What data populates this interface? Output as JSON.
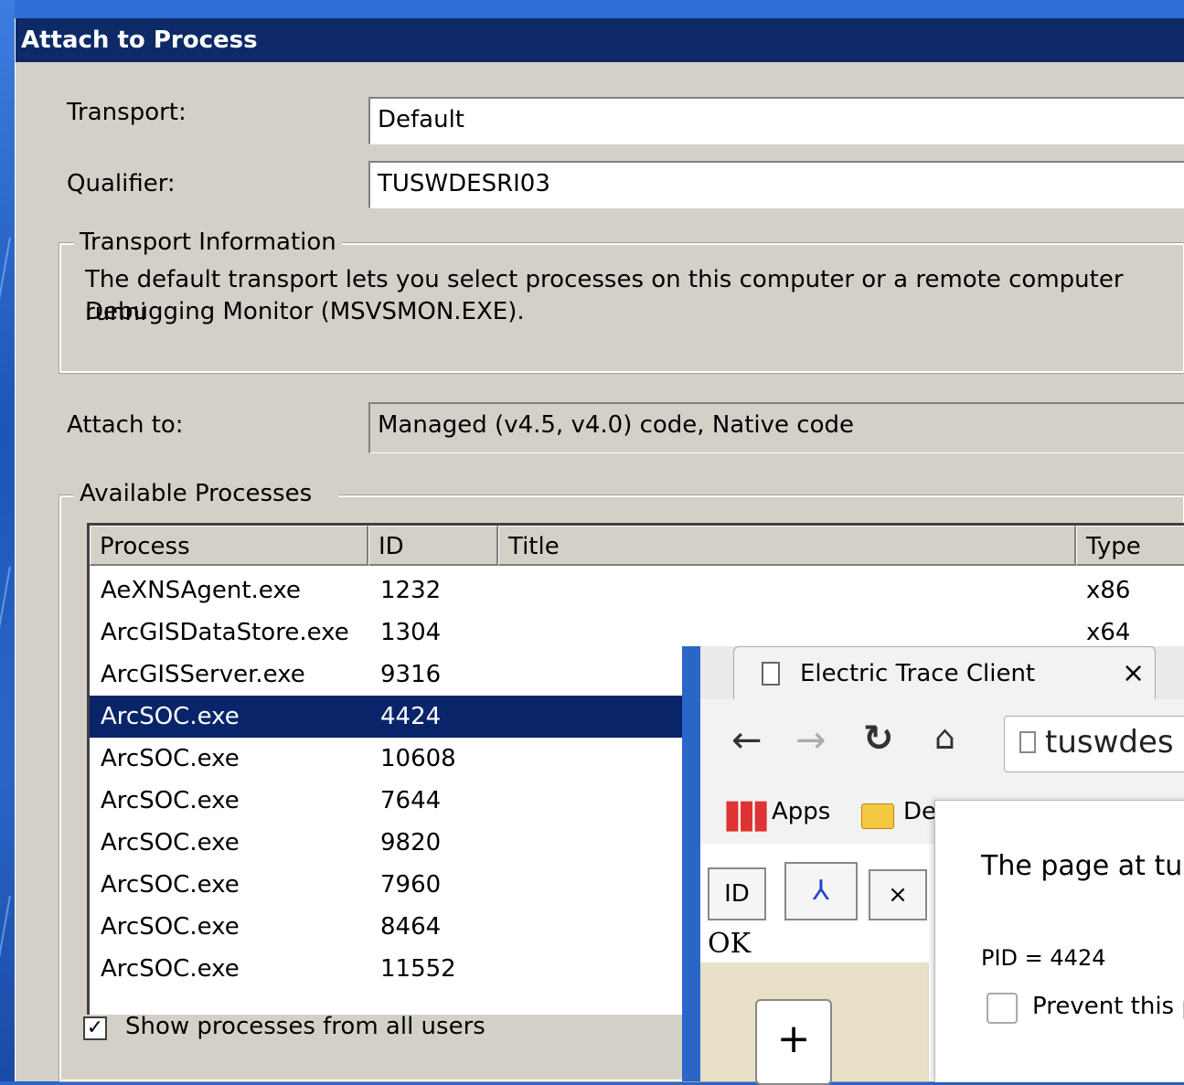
{
  "dialog": {
    "title": "Attach to Process",
    "transport_label": "Transport:",
    "transport_value": "Default",
    "qualifier_label": "Qualifier:",
    "qualifier_value": "TUSWDESRI03",
    "transport_info_title": "Transport Information",
    "transport_info_line1": "The default transport lets you select processes on this computer or a remote computer runni",
    "transport_info_line2": "Debugging Monitor (MSVSMON.EXE).",
    "attach_to_label": "Attach to:",
    "attach_to_value": "Managed (v4.5, v4.0) code, Native code",
    "available_processes_title": "Available Processes",
    "columns": [
      "Process",
      "ID",
      "Title",
      "Type"
    ],
    "processes": [
      {
        "process": "AeXNSAgent.exe",
        "id": "1232",
        "title": "",
        "type": "x86"
      },
      {
        "process": "ArcGISDataStore.exe",
        "id": "1304",
        "title": "",
        "type": "x64"
      },
      {
        "process": "ArcGISServer.exe",
        "id": "9316",
        "title": "",
        "type": ""
      },
      {
        "process": "ArcSOC.exe",
        "id": "4424",
        "title": "",
        "type": ""
      },
      {
        "process": "ArcSOC.exe",
        "id": "10608",
        "title": "",
        "type": ""
      },
      {
        "process": "ArcSOC.exe",
        "id": "7644",
        "title": "",
        "type": ""
      },
      {
        "process": "ArcSOC.exe",
        "id": "9820",
        "title": "",
        "type": ""
      },
      {
        "process": "ArcSOC.exe",
        "id": "7960",
        "title": "",
        "type": ""
      },
      {
        "process": "ArcSOC.exe",
        "id": "8464",
        "title": "",
        "type": ""
      },
      {
        "process": "ArcSOC.exe",
        "id": "11552",
        "title": "",
        "type": ""
      }
    ],
    "selected_index": 3,
    "show_all_users_label": "Show processes from all users",
    "show_all_users_checked": true
  },
  "browser": {
    "tab_title": "Electric Trace Client",
    "address": "tuswdes",
    "bookmark_apps": "Apps",
    "bookmark_folder": "De",
    "tool_id_label": "ID",
    "tool_close_label": "×",
    "ok_label": "OK",
    "zoom_in_label": "+",
    "popup_message": "The page at tu",
    "popup_pid": "PID = 4424",
    "popup_prevent_label": "Prevent this p"
  },
  "colors": {
    "desktop_blue": "#2a66c8",
    "titlebar": "#0d2a66",
    "selection": "#0a246a",
    "dialog_face": "#d4d0c8"
  }
}
